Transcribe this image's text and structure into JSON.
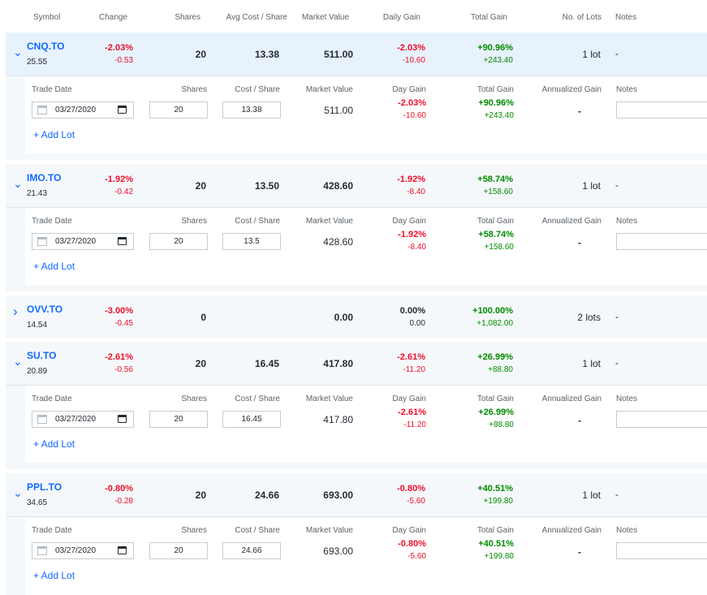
{
  "headers": {
    "symbol": "Symbol",
    "change": "Change",
    "shares": "Shares",
    "avg_cost": "Avg Cost / Share",
    "market_value": "Market Value",
    "daily_gain": "Daily Gain",
    "total_gain": "Total Gain",
    "lots": "No. of Lots",
    "notes": "Notes"
  },
  "lot_headers": {
    "trade_date": "Trade Date",
    "shares": "Shares",
    "cost_share": "Cost / Share",
    "market_value": "Market Value",
    "day_gain": "Day Gain",
    "total_gain": "Total Gain",
    "annualized_gain": "Annualized Gain",
    "notes": "Notes"
  },
  "add_lot_label": "+ Add Lot",
  "holdings": [
    {
      "symbol": "CNQ.TO",
      "price": "25.55",
      "change_pct": "-2.03%",
      "change_abs": "-0.53",
      "shares": "20",
      "avg_cost": "13.38",
      "market_value": "511.00",
      "daily_pct": "-2.03%",
      "daily_abs": "-10.60",
      "total_pct": "+90.96%",
      "total_abs": "+243.40",
      "lots": "1 lot",
      "notes": "-",
      "lot": {
        "date": "03/27/2020",
        "shares": "20",
        "cost": "13.38",
        "market_value": "511.00",
        "day_pct": "-2.03%",
        "day_abs": "-10.60",
        "total_pct": "+90.96%",
        "total_abs": "+243.40",
        "annualized": "-"
      }
    },
    {
      "symbol": "IMO.TO",
      "price": "21.43",
      "change_pct": "-1.92%",
      "change_abs": "-0.42",
      "shares": "20",
      "avg_cost": "13.50",
      "market_value": "428.60",
      "daily_pct": "-1.92%",
      "daily_abs": "-8.40",
      "total_pct": "+58.74%",
      "total_abs": "+158.60",
      "lots": "1 lot",
      "notes": "-",
      "lot": {
        "date": "03/27/2020",
        "shares": "20",
        "cost": "13.5",
        "market_value": "428.60",
        "day_pct": "-1.92%",
        "day_abs": "-8.40",
        "total_pct": "+58.74%",
        "total_abs": "+158.60",
        "annualized": "-"
      }
    },
    {
      "symbol": "OVV.TO",
      "price": "14.54",
      "change_pct": "-3.00%",
      "change_abs": "-0.45",
      "shares": "0",
      "avg_cost": "",
      "market_value": "0.00",
      "daily_pct": "0.00%",
      "daily_abs": "0.00",
      "total_pct": "+100.00%",
      "total_abs": "+1,082.00",
      "lots": "2 lots",
      "notes": "-"
    },
    {
      "symbol": "SU.TO",
      "price": "20.89",
      "change_pct": "-2.61%",
      "change_abs": "-0.56",
      "shares": "20",
      "avg_cost": "16.45",
      "market_value": "417.80",
      "daily_pct": "-2.61%",
      "daily_abs": "-11.20",
      "total_pct": "+26.99%",
      "total_abs": "+88.80",
      "lots": "1 lot",
      "notes": "-",
      "lot": {
        "date": "03/27/2020",
        "shares": "20",
        "cost": "16.45",
        "market_value": "417.80",
        "day_pct": "-2.61%",
        "day_abs": "-11.20",
        "total_pct": "+26.99%",
        "total_abs": "+88.80",
        "annualized": "-"
      }
    },
    {
      "symbol": "PPL.TO",
      "price": "34.65",
      "change_pct": "-0.80%",
      "change_abs": "-0.28",
      "shares": "20",
      "avg_cost": "24.66",
      "market_value": "693.00",
      "daily_pct": "-0.80%",
      "daily_abs": "-5.60",
      "total_pct": "+40.51%",
      "total_abs": "+199.80",
      "lots": "1 lot",
      "notes": "-",
      "lot": {
        "date": "03/27/2020",
        "shares": "20",
        "cost": "24.66",
        "market_value": "693.00",
        "day_pct": "-0.80%",
        "day_abs": "-5.60",
        "total_pct": "+40.51%",
        "total_abs": "+199.80",
        "annualized": "-"
      }
    }
  ],
  "colors": {
    "link": "#0f69ff",
    "negative": "#eb0f29",
    "positive": "#008a00",
    "selected_row": "#e7f2fd"
  },
  "icons": {
    "expanded": "chevron-down-icon",
    "collapsed": "chevron-right-icon",
    "date": "calendar-icon"
  }
}
